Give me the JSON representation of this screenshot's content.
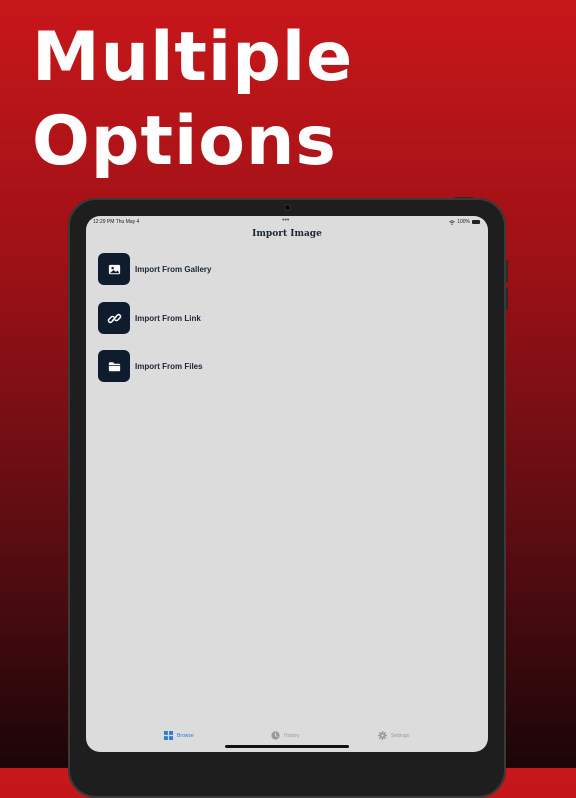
{
  "headline": {
    "line1": "Multiple",
    "line2": "Options"
  },
  "status_bar": {
    "time_date": "12:29 PM   Thu May 4",
    "battery": "100%"
  },
  "nav": {
    "title": "Import Image"
  },
  "options": [
    {
      "label": "Import From Gallery",
      "icon": "photo-icon"
    },
    {
      "label": "Import From Link",
      "icon": "link-icon"
    },
    {
      "label": "Import From Files",
      "icon": "folder-icon"
    }
  ],
  "tabs": [
    {
      "label": "Browse",
      "icon": "grid-icon",
      "active": true
    },
    {
      "label": "History",
      "icon": "clock-icon",
      "active": false
    },
    {
      "label": "Settings",
      "icon": "gear-icon",
      "active": false
    }
  ],
  "colors": {
    "accent": "#2a7ae2",
    "icon_bg": "#0f1c2e",
    "screen_bg": "#dcdcdc"
  }
}
